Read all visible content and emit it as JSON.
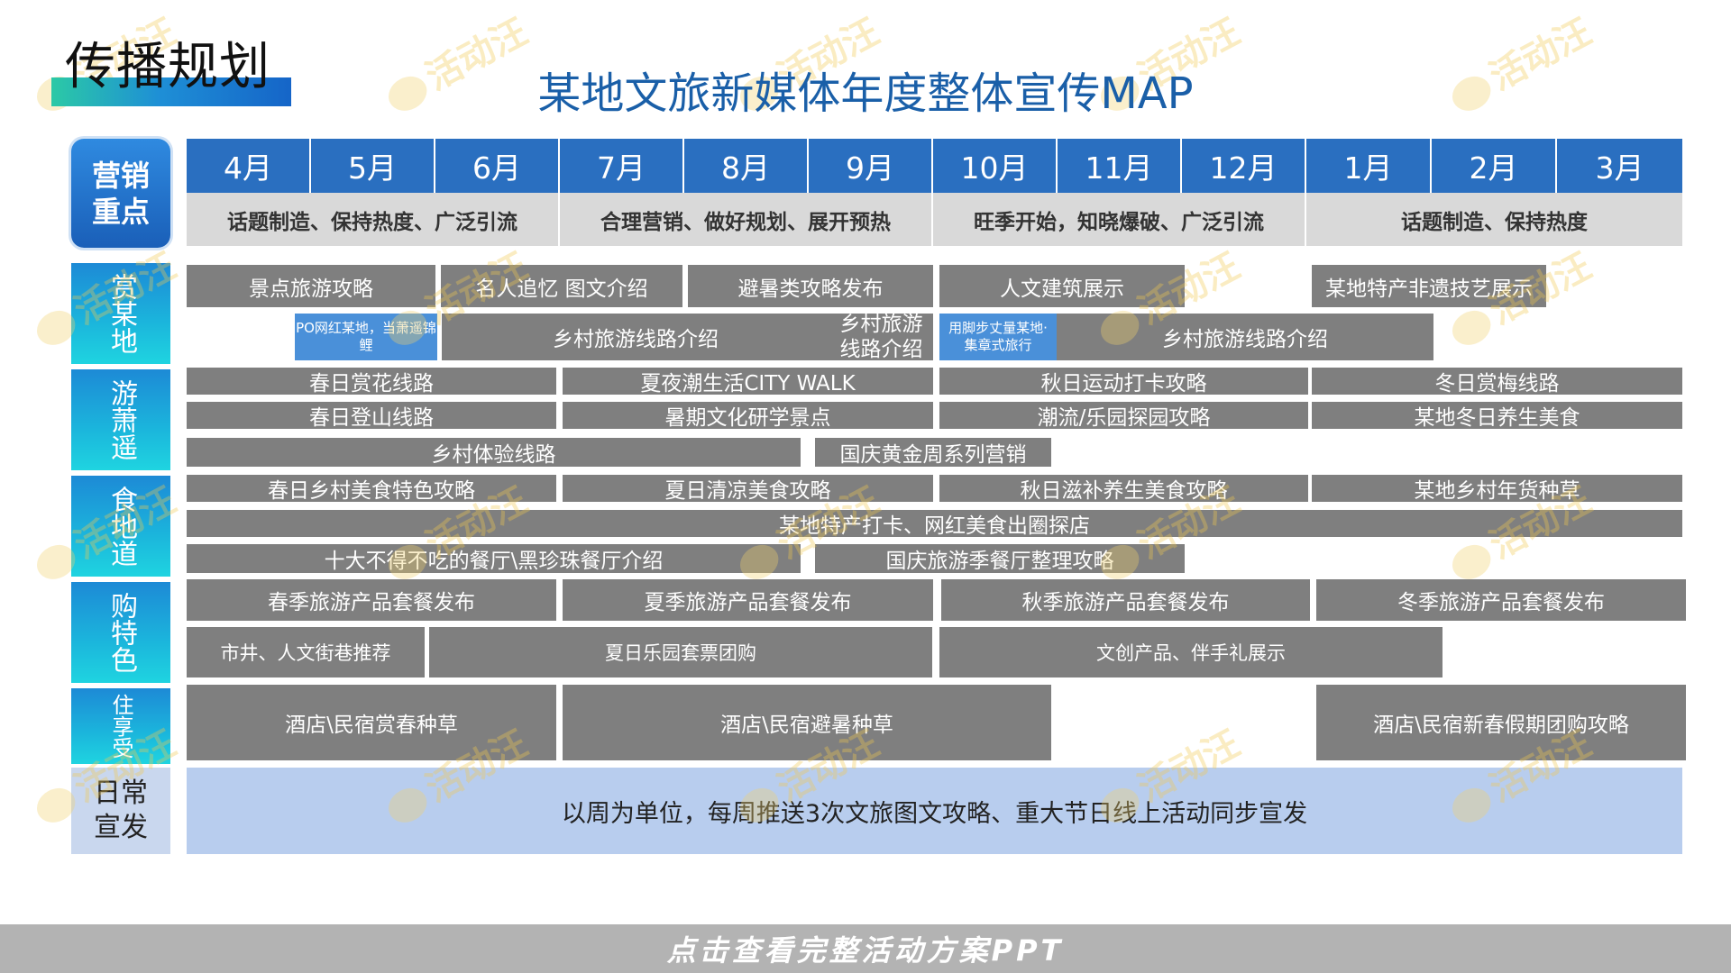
{
  "heading": "传播规划",
  "title": "某地文旅新媒体年度整体宣传MAP",
  "months": [
    "4月",
    "5月",
    "6月",
    "7月",
    "8月",
    "9月",
    "10月",
    "11月",
    "12月",
    "1月",
    "2月",
    "3月"
  ],
  "focus_label": "营销\n重点",
  "themes": [
    "话题制造、保持热度、广泛引流",
    "合理营销、做好规划、展开预热",
    "旺季开始，知晓爆破、广泛引流",
    "话题制造、保持热度"
  ],
  "categories": {
    "shang": "赏某地",
    "you": "游萧遥",
    "shi": "食地道",
    "gou": "购特色",
    "zhu": "住享受",
    "daily": "日常\n宣发"
  },
  "rows": {
    "shang1": [
      "景点旅游攻略",
      "名人追忆 图文介绍",
      "避暑类攻略发布",
      "人文建筑展示",
      "某地特产非遗技艺展示"
    ],
    "shang2": [
      "PO网红某地，当萧遥锦鲤",
      "乡村旅游线路介绍",
      "乡村旅游线路介绍",
      "用脚步丈量某地·集章式旅行",
      "乡村旅游线路介绍"
    ],
    "you1": [
      "春日赏花线路",
      "夏夜潮生活CITY WALK",
      "秋日运动打卡攻略",
      "冬日赏梅线路"
    ],
    "you2": [
      "春日登山线路",
      "暑期文化研学景点",
      "潮流/乐园探园攻略",
      "某地冬日养生美食"
    ],
    "you3": [
      "乡村体验线路",
      "国庆黄金周系列营销"
    ],
    "shi1": [
      "春日乡村美食特色攻略",
      "夏日清凉美食攻略",
      "秋日滋补养生美食攻略",
      "某地乡村年货种草"
    ],
    "shi2": [
      "某地特产打卡、网红美食出圈探店"
    ],
    "shi3": [
      "十大不得不吃的餐厅\\黑珍珠餐厅介绍",
      "国庆旅游季餐厅整理攻略"
    ],
    "gou1": [
      "春季旅游产品套餐发布",
      "夏季旅游产品套餐发布",
      "秋季旅游产品套餐发布",
      "冬季旅游产品套餐发布"
    ],
    "gou2": [
      "市井、人文街巷推荐",
      "夏日乐园套票团购",
      "文创产品、伴手礼展示"
    ],
    "zhu1": [
      "酒店\\民宿赏春种草",
      "酒店\\民宿避暑种草",
      "酒店\\民宿新春假期团购攻略"
    ]
  },
  "daily_text": "以周为单位，每周推送3次文旅图文攻略、重大节日线上活动同步宣发",
  "footer": "点击查看完整活动方案PPT",
  "watermark": "活动汪",
  "colors": {
    "month_bg": "#2a6fc0",
    "theme_bg": "#d9d9d9",
    "bar_bg": "#7f7f7f",
    "blue_bar": "#4a90d9",
    "daily_bg": "#b8cdee",
    "title": "#1a5fa8"
  }
}
